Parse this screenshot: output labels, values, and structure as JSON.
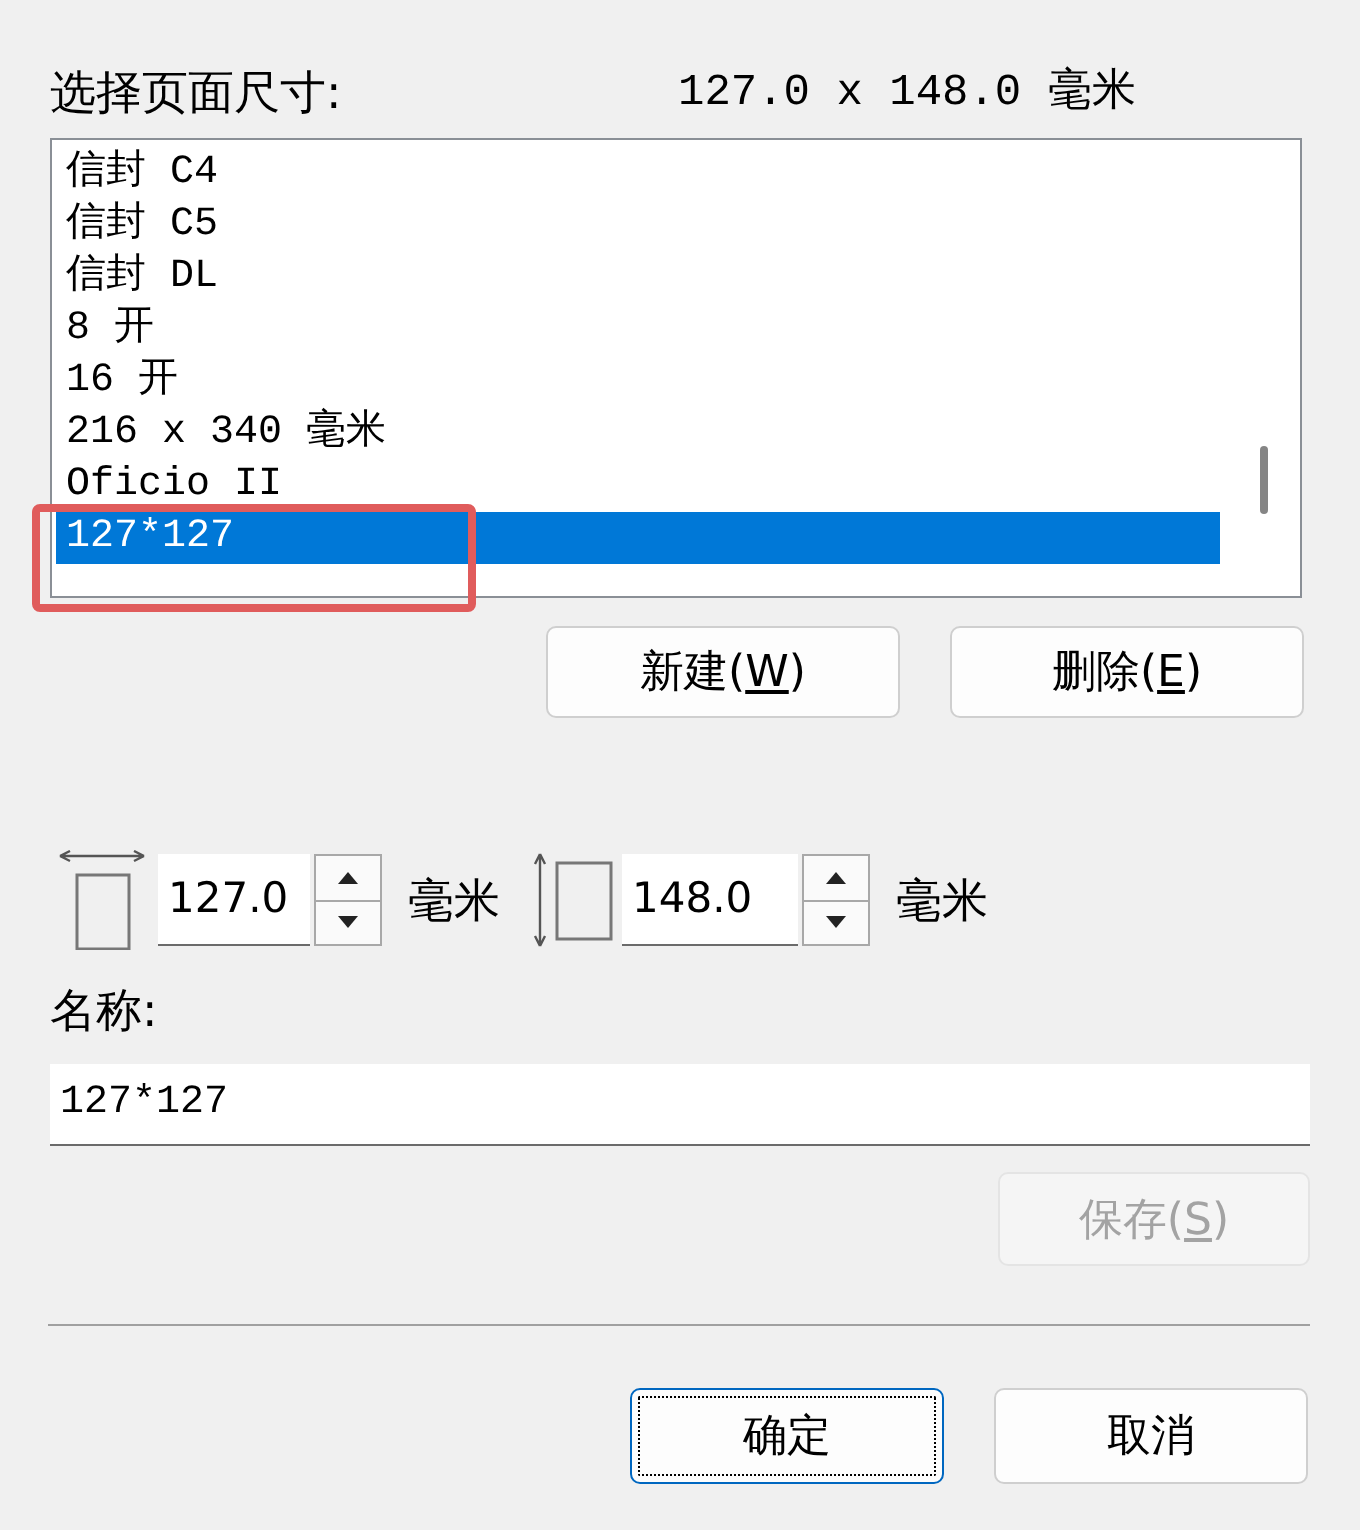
{
  "page_size": {
    "label": "选择页面尺寸:",
    "dimensions": "127.0 x 148.0 毫米"
  },
  "paper_list": {
    "items": [
      {
        "label": "信封 C4",
        "selected": false
      },
      {
        "label": "信封 C5",
        "selected": false
      },
      {
        "label": "信封 DL",
        "selected": false
      },
      {
        "label": "8 开",
        "selected": false
      },
      {
        "label": "16 开",
        "selected": false
      },
      {
        "label": "216 x 340 毫米",
        "selected": false
      },
      {
        "label": "Oficio II",
        "selected": false
      },
      {
        "label": "127*127",
        "selected": true
      }
    ]
  },
  "list_buttons": [
    {
      "label": "新建(W)",
      "disabled": false
    },
    {
      "label": "删除(E)",
      "disabled": false
    }
  ],
  "size_fields": [
    {
      "kind": "width",
      "value": "127.0",
      "unit": "毫米"
    },
    {
      "kind": "height",
      "value": "148.0",
      "unit": "毫米"
    }
  ],
  "name_field": {
    "label": "名称:",
    "value": "127*127"
  },
  "save_button": {
    "label": "保存(S)",
    "disabled": true
  },
  "dialog_buttons": [
    {
      "label": "确定",
      "focused": true
    },
    {
      "label": "取消",
      "focused": false
    }
  ]
}
